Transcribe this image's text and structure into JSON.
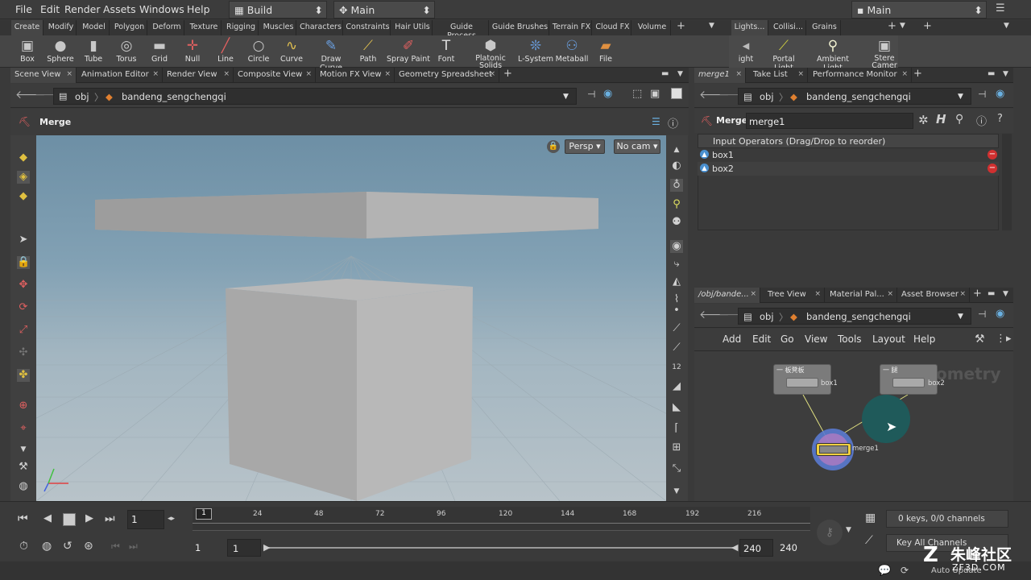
{
  "menubar": {
    "items": [
      "File",
      "Edit",
      "Render",
      "Assets",
      "Windows",
      "Help"
    ],
    "desktop": "Build",
    "context": "Main",
    "right_context": "Main"
  },
  "shelf_tabs": [
    "Create",
    "Modify",
    "Model",
    "Polygon",
    "Deform",
    "Texture",
    "Rigging",
    "Muscles",
    "Characters",
    "Constraints",
    "Hair Utils",
    "Guide Process",
    "Guide Brushes",
    "Terrain FX",
    "Cloud FX",
    "Volume"
  ],
  "shelf_tabs_right": [
    "Lights...",
    "Collisi...",
    "Grains"
  ],
  "tools": [
    {
      "label": "Box",
      "icon": "▣"
    },
    {
      "label": "Sphere",
      "icon": "●"
    },
    {
      "label": "Tube",
      "icon": "▮"
    },
    {
      "label": "Torus",
      "icon": "◎"
    },
    {
      "label": "Grid",
      "icon": "▬"
    },
    {
      "label": "Null",
      "icon": "✛"
    },
    {
      "label": "Line",
      "icon": "╱"
    },
    {
      "label": "Circle",
      "icon": "○"
    },
    {
      "label": "Curve",
      "icon": "∿"
    },
    {
      "label": "Draw Curve",
      "icon": "✎"
    },
    {
      "label": "Path",
      "icon": "⟋"
    },
    {
      "label": "Spray Paint",
      "icon": "✐"
    },
    {
      "label": "Font",
      "icon": "T"
    },
    {
      "label": "Platonic Solids",
      "icon": "⬢"
    },
    {
      "label": "L-System",
      "icon": "❊"
    },
    {
      "label": "Metaball",
      "icon": "⚇"
    },
    {
      "label": "File",
      "icon": "▰"
    }
  ],
  "tools_right": [
    {
      "label": "ight",
      "icon": "◂"
    },
    {
      "label": "Portal Light",
      "icon": "⟋"
    },
    {
      "label": "Ambient Light",
      "icon": "⚲"
    },
    {
      "label": "Stere Camer",
      "icon": "▣"
    }
  ],
  "left_tabs": [
    "Scene View",
    "Animation Editor",
    "Render View",
    "Composite View",
    "Motion FX View",
    "Geometry Spreadsheet"
  ],
  "right_top_tabs": [
    "merge1",
    "Take List",
    "Performance Monitor"
  ],
  "right_bottom_tabs": [
    "/obj/bande...",
    "Tree View",
    "Material Pal...",
    "Asset Browser"
  ],
  "path": {
    "root": "obj",
    "node": "bandeng_sengchengqi"
  },
  "viewer": {
    "title": "Merge",
    "persp": "Persp ▾",
    "cam": "No cam ▾"
  },
  "params": {
    "type": "Merge",
    "name": "merge1",
    "header": "Input Operators (Drag/Drop to reorder)",
    "inputs": [
      "box1",
      "box2"
    ]
  },
  "network": {
    "menu": [
      "Add",
      "Edit",
      "Go",
      "View",
      "Tools",
      "Layout",
      "Help"
    ],
    "watermark": "Geometry",
    "nodes": [
      {
        "header": "一 板凳板",
        "label": "box1"
      },
      {
        "header": "一 腿",
        "label": "box2"
      },
      {
        "header": "",
        "label": "merge1"
      }
    ]
  },
  "timeline": {
    "frame": "1",
    "ticks": [
      "24",
      "48",
      "72",
      "96",
      "120",
      "144",
      "168",
      "192",
      "216"
    ],
    "start": "1",
    "start2": "1",
    "end": "240",
    "end2": "240",
    "channels": "0 keys, 0/0 channels",
    "keyall": "Key All Channels",
    "autoupdate": "Auto Update"
  },
  "watermark": {
    "line1": "朱峰社区",
    "line2": "ZF3D.COM"
  }
}
